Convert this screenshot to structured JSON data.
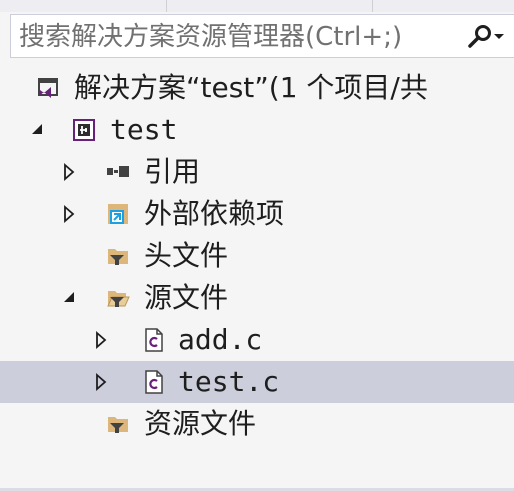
{
  "search": {
    "placeholder": "搜索解决方案资源管理器(Ctrl+;)",
    "icon": "magnifier-icon",
    "dropdown_icon": "chevron-down-icon"
  },
  "tree": {
    "solution": {
      "label": "解决方案“test”(1 个项目/共",
      "icon": "solution-icon"
    },
    "project": {
      "label": "test",
      "icon": "cpp-project-icon",
      "expanded": true
    },
    "references": {
      "label": "引用",
      "icon": "references-icon",
      "expanded": false
    },
    "external": {
      "label": "外部依赖项",
      "icon": "external-dependencies-icon",
      "expanded": false
    },
    "headers": {
      "label": "头文件",
      "icon": "filter-folder-icon"
    },
    "sources": {
      "label": "源文件",
      "icon": "filter-folder-open-icon",
      "expanded": true
    },
    "file_add": {
      "label": "add.c",
      "icon": "c-file-icon",
      "expanded": false
    },
    "file_test": {
      "label": "test.c",
      "icon": "c-file-icon",
      "expanded": false,
      "selected": true
    },
    "resources": {
      "label": "资源文件",
      "icon": "filter-folder-icon"
    }
  },
  "colors": {
    "selection": "#cccedb",
    "background": "#f5f5f5",
    "vs_purple": "#68217a",
    "folder_tan": "#dcb67a",
    "blue_accent": "#1ba1e2"
  }
}
